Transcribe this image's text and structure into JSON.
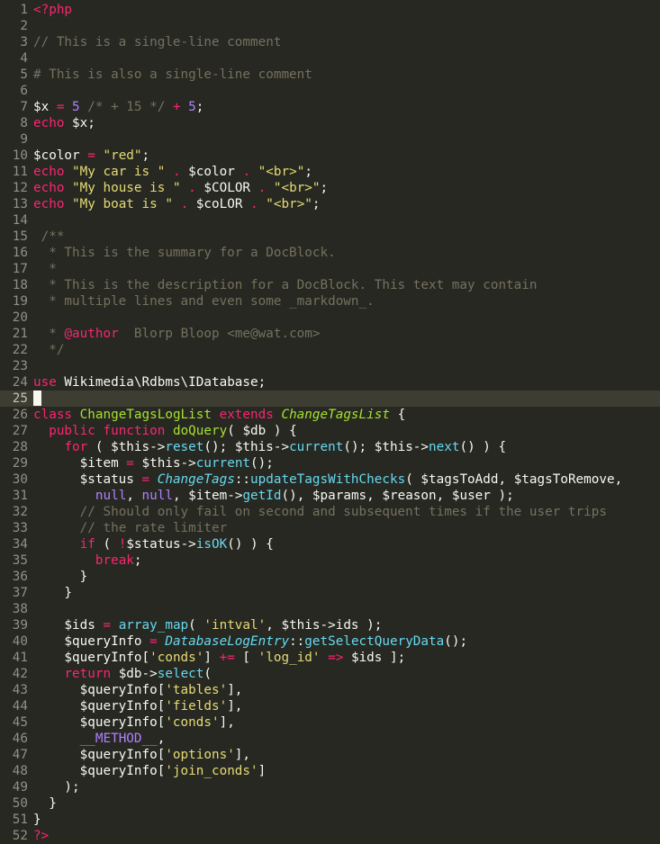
{
  "editor": {
    "language": "php",
    "current_line": 25,
    "colors": {
      "background": "#272822",
      "current_line_bg": "#3e3d32",
      "gutter_text": "#90908a",
      "keyword": "#f92672",
      "string": "#e6db74",
      "number": "#ae81ff",
      "comment": "#75715e",
      "function": "#a6e22e",
      "method": "#66d9ef",
      "text": "#f8f8f2"
    },
    "lines": [
      {
        "n": "1",
        "tokens": [
          [
            "tag",
            "<?php"
          ]
        ]
      },
      {
        "n": "2",
        "tokens": []
      },
      {
        "n": "3",
        "tokens": [
          [
            "cmt",
            "// This is a single-line comment"
          ]
        ]
      },
      {
        "n": "4",
        "tokens": []
      },
      {
        "n": "5",
        "tokens": [
          [
            "cmt",
            "# This is also a single-line comment"
          ]
        ]
      },
      {
        "n": "6",
        "tokens": []
      },
      {
        "n": "7",
        "tokens": [
          [
            "var",
            "$x"
          ],
          [
            "plain",
            " "
          ],
          [
            "op",
            "="
          ],
          [
            "plain",
            " "
          ],
          [
            "num",
            "5"
          ],
          [
            "plain",
            " "
          ],
          [
            "cmt",
            "/* + 15 */"
          ],
          [
            "plain",
            " "
          ],
          [
            "op",
            "+"
          ],
          [
            "plain",
            " "
          ],
          [
            "num",
            "5"
          ],
          [
            "plain",
            ";"
          ]
        ]
      },
      {
        "n": "8",
        "tokens": [
          [
            "kw",
            "echo"
          ],
          [
            "plain",
            " $x;"
          ]
        ]
      },
      {
        "n": "9",
        "tokens": []
      },
      {
        "n": "10",
        "tokens": [
          [
            "var",
            "$color"
          ],
          [
            "plain",
            " "
          ],
          [
            "op",
            "="
          ],
          [
            "plain",
            " "
          ],
          [
            "str",
            "\"red\""
          ],
          [
            "plain",
            ";"
          ]
        ]
      },
      {
        "n": "11",
        "tokens": [
          [
            "kw",
            "echo"
          ],
          [
            "plain",
            " "
          ],
          [
            "str",
            "\"My car is \""
          ],
          [
            "plain",
            " "
          ],
          [
            "op",
            "."
          ],
          [
            "plain",
            " $color "
          ],
          [
            "op",
            "."
          ],
          [
            "plain",
            " "
          ],
          [
            "str",
            "\"<br>\""
          ],
          [
            "plain",
            ";"
          ]
        ]
      },
      {
        "n": "12",
        "tokens": [
          [
            "kw",
            "echo"
          ],
          [
            "plain",
            " "
          ],
          [
            "str",
            "\"My house is \""
          ],
          [
            "plain",
            " "
          ],
          [
            "op",
            "."
          ],
          [
            "plain",
            " $COLOR "
          ],
          [
            "op",
            "."
          ],
          [
            "plain",
            " "
          ],
          [
            "str",
            "\"<br>\""
          ],
          [
            "plain",
            ";"
          ]
        ]
      },
      {
        "n": "13",
        "tokens": [
          [
            "kw",
            "echo"
          ],
          [
            "plain",
            " "
          ],
          [
            "str",
            "\"My boat is \""
          ],
          [
            "plain",
            " "
          ],
          [
            "op",
            "."
          ],
          [
            "plain",
            " $coLOR "
          ],
          [
            "op",
            "."
          ],
          [
            "plain",
            " "
          ],
          [
            "str",
            "\"<br>\""
          ],
          [
            "plain",
            ";"
          ]
        ]
      },
      {
        "n": "14",
        "tokens": []
      },
      {
        "n": "15",
        "tokens": [
          [
            "cmt",
            " /**"
          ]
        ]
      },
      {
        "n": "16",
        "tokens": [
          [
            "cmt",
            "  * This is the summary for a DocBlock."
          ]
        ]
      },
      {
        "n": "17",
        "tokens": [
          [
            "cmt",
            "  *"
          ]
        ]
      },
      {
        "n": "18",
        "tokens": [
          [
            "cmt",
            "  * This is the description for a DocBlock. This text may contain"
          ]
        ]
      },
      {
        "n": "19",
        "tokens": [
          [
            "cmt",
            "  * multiple lines and even some _markdown_."
          ]
        ]
      },
      {
        "n": "20",
        "tokens": []
      },
      {
        "n": "21",
        "tokens": [
          [
            "cmt",
            "  * "
          ],
          [
            "cmt-tag",
            "@author"
          ],
          [
            "cmt-val",
            "  Blorp Bloop <me@wat.com>"
          ]
        ]
      },
      {
        "n": "22",
        "tokens": [
          [
            "cmt",
            "  */"
          ]
        ]
      },
      {
        "n": "23",
        "tokens": []
      },
      {
        "n": "24",
        "tokens": [
          [
            "kw",
            "use"
          ],
          [
            "plain",
            " Wikimedia\\Rdbms\\IDatabase;"
          ]
        ]
      },
      {
        "n": "25",
        "tokens": []
      },
      {
        "n": "26",
        "tokens": [
          [
            "kw",
            "class"
          ],
          [
            "plain",
            " "
          ],
          [
            "cls",
            "ChangeTagsLogList"
          ],
          [
            "plain",
            " "
          ],
          [
            "kw",
            "extends"
          ],
          [
            "plain",
            " "
          ],
          [
            "cls-i",
            "ChangeTagsList"
          ],
          [
            "plain",
            " {"
          ]
        ]
      },
      {
        "n": "27",
        "tokens": [
          [
            "plain",
            "  "
          ],
          [
            "kw",
            "public"
          ],
          [
            "plain",
            " "
          ],
          [
            "kw",
            "function"
          ],
          [
            "plain",
            " "
          ],
          [
            "fn",
            "doQuery"
          ],
          [
            "plain",
            "( $db ) {"
          ]
        ]
      },
      {
        "n": "28",
        "tokens": [
          [
            "plain",
            "    "
          ],
          [
            "kw",
            "for"
          ],
          [
            "plain",
            " ( $this->"
          ],
          [
            "call",
            "reset"
          ],
          [
            "plain",
            "(); $this->"
          ],
          [
            "call",
            "current"
          ],
          [
            "plain",
            "(); $this->"
          ],
          [
            "call",
            "next"
          ],
          [
            "plain",
            "() ) {"
          ]
        ]
      },
      {
        "n": "29",
        "tokens": [
          [
            "plain",
            "      $item "
          ],
          [
            "op",
            "="
          ],
          [
            "plain",
            " $this->"
          ],
          [
            "call",
            "current"
          ],
          [
            "plain",
            "();"
          ]
        ]
      },
      {
        "n": "30",
        "tokens": [
          [
            "plain",
            "      $status "
          ],
          [
            "op",
            "="
          ],
          [
            "plain",
            " "
          ],
          [
            "type",
            "ChangeTags"
          ],
          [
            "plain",
            "::"
          ],
          [
            "call",
            "updateTagsWithChecks"
          ],
          [
            "plain",
            "( $tagsToAdd, $tagsToRemove,"
          ]
        ]
      },
      {
        "n": "31",
        "tokens": [
          [
            "plain",
            "        "
          ],
          [
            "const",
            "null"
          ],
          [
            "plain",
            ", "
          ],
          [
            "const",
            "null"
          ],
          [
            "plain",
            ", $item->"
          ],
          [
            "call",
            "getId"
          ],
          [
            "plain",
            "(), $params, $reason, $user );"
          ]
        ]
      },
      {
        "n": "32",
        "tokens": [
          [
            "plain",
            "      "
          ],
          [
            "cmt",
            "// Should only fail on second and subsequent times if the user trips"
          ]
        ]
      },
      {
        "n": "33",
        "tokens": [
          [
            "plain",
            "      "
          ],
          [
            "cmt",
            "// the rate limiter"
          ]
        ]
      },
      {
        "n": "34",
        "tokens": [
          [
            "plain",
            "      "
          ],
          [
            "kw",
            "if"
          ],
          [
            "plain",
            " ( "
          ],
          [
            "op",
            "!"
          ],
          [
            "plain",
            "$status->"
          ],
          [
            "call",
            "isOK"
          ],
          [
            "plain",
            "() ) {"
          ]
        ]
      },
      {
        "n": "35",
        "tokens": [
          [
            "plain",
            "        "
          ],
          [
            "kw",
            "break"
          ],
          [
            "plain",
            ";"
          ]
        ]
      },
      {
        "n": "36",
        "tokens": [
          [
            "plain",
            "      }"
          ]
        ]
      },
      {
        "n": "37",
        "tokens": [
          [
            "plain",
            "    }"
          ]
        ]
      },
      {
        "n": "38",
        "tokens": []
      },
      {
        "n": "39",
        "tokens": [
          [
            "plain",
            "    $ids "
          ],
          [
            "op",
            "="
          ],
          [
            "plain",
            " "
          ],
          [
            "call",
            "array_map"
          ],
          [
            "plain",
            "( "
          ],
          [
            "str",
            "'intval'"
          ],
          [
            "plain",
            ", $this->ids );"
          ]
        ]
      },
      {
        "n": "40",
        "tokens": [
          [
            "plain",
            "    $queryInfo "
          ],
          [
            "op",
            "="
          ],
          [
            "plain",
            " "
          ],
          [
            "type",
            "DatabaseLogEntry"
          ],
          [
            "plain",
            "::"
          ],
          [
            "call",
            "getSelectQueryData"
          ],
          [
            "plain",
            "();"
          ]
        ]
      },
      {
        "n": "41",
        "tokens": [
          [
            "plain",
            "    $queryInfo["
          ],
          [
            "str",
            "'conds'"
          ],
          [
            "plain",
            "] "
          ],
          [
            "op",
            "+="
          ],
          [
            "plain",
            " [ "
          ],
          [
            "str",
            "'log_id'"
          ],
          [
            "plain",
            " "
          ],
          [
            "op",
            "=>"
          ],
          [
            "plain",
            " $ids ];"
          ]
        ]
      },
      {
        "n": "42",
        "tokens": [
          [
            "plain",
            "    "
          ],
          [
            "kw",
            "return"
          ],
          [
            "plain",
            " $db->"
          ],
          [
            "call",
            "select"
          ],
          [
            "plain",
            "("
          ]
        ]
      },
      {
        "n": "43",
        "tokens": [
          [
            "plain",
            "      $queryInfo["
          ],
          [
            "str",
            "'tables'"
          ],
          [
            "plain",
            "],"
          ]
        ]
      },
      {
        "n": "44",
        "tokens": [
          [
            "plain",
            "      $queryInfo["
          ],
          [
            "str",
            "'fields'"
          ],
          [
            "plain",
            "],"
          ]
        ]
      },
      {
        "n": "45",
        "tokens": [
          [
            "plain",
            "      $queryInfo["
          ],
          [
            "str",
            "'conds'"
          ],
          [
            "plain",
            "],"
          ]
        ]
      },
      {
        "n": "46",
        "tokens": [
          [
            "plain",
            "      "
          ],
          [
            "const",
            "__METHOD__"
          ],
          [
            "plain",
            ","
          ]
        ]
      },
      {
        "n": "47",
        "tokens": [
          [
            "plain",
            "      $queryInfo["
          ],
          [
            "str",
            "'options'"
          ],
          [
            "plain",
            "],"
          ]
        ]
      },
      {
        "n": "48",
        "tokens": [
          [
            "plain",
            "      $queryInfo["
          ],
          [
            "str",
            "'join_conds'"
          ],
          [
            "plain",
            "]"
          ]
        ]
      },
      {
        "n": "49",
        "tokens": [
          [
            "plain",
            "    );"
          ]
        ]
      },
      {
        "n": "50",
        "tokens": [
          [
            "plain",
            "  }"
          ]
        ]
      },
      {
        "n": "51",
        "tokens": [
          [
            "plain",
            "}"
          ]
        ]
      },
      {
        "n": "52",
        "tokens": [
          [
            "tag",
            "?>"
          ]
        ]
      }
    ]
  }
}
